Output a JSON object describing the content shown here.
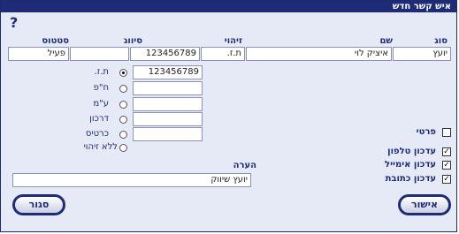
{
  "dialog": {
    "title": "איש קשר חדש",
    "help": "?"
  },
  "headers": {
    "type": "סוג",
    "name": "שם",
    "id": "זיהוי",
    "classification": "סיווג",
    "status": "סטטוס"
  },
  "row": {
    "type": "יועץ",
    "name": "איציק לוי",
    "id_type": "ת.ז.",
    "id_number": "123456789",
    "classification": "",
    "status": "פעיל"
  },
  "id_options": [
    {
      "label": "ת.ז.",
      "value": "123456789",
      "selected": true
    },
    {
      "label": "ח\"פ",
      "value": "",
      "selected": false
    },
    {
      "label": "ע\"מ",
      "value": "",
      "selected": false
    },
    {
      "label": "דרכון",
      "value": "",
      "selected": false
    },
    {
      "label": "כרטיס",
      "value": "",
      "selected": false
    },
    {
      "label": "ללא זיהוי",
      "value": null,
      "selected": false
    }
  ],
  "checkboxes": {
    "private": {
      "label": "פרטי",
      "checked": false
    },
    "update_phone": {
      "label": "עדכון טלפון",
      "checked": true
    },
    "update_email": {
      "label": "עדכון אימייל",
      "checked": true
    },
    "update_address": {
      "label": "עדכון כתובת",
      "checked": true
    }
  },
  "note": {
    "label": "הערה",
    "value": "יועץ שיווק"
  },
  "buttons": {
    "ok": "אישור",
    "close": "סגור"
  },
  "colors": {
    "accent": "#1e2c78",
    "background": "#e6eaf6"
  }
}
